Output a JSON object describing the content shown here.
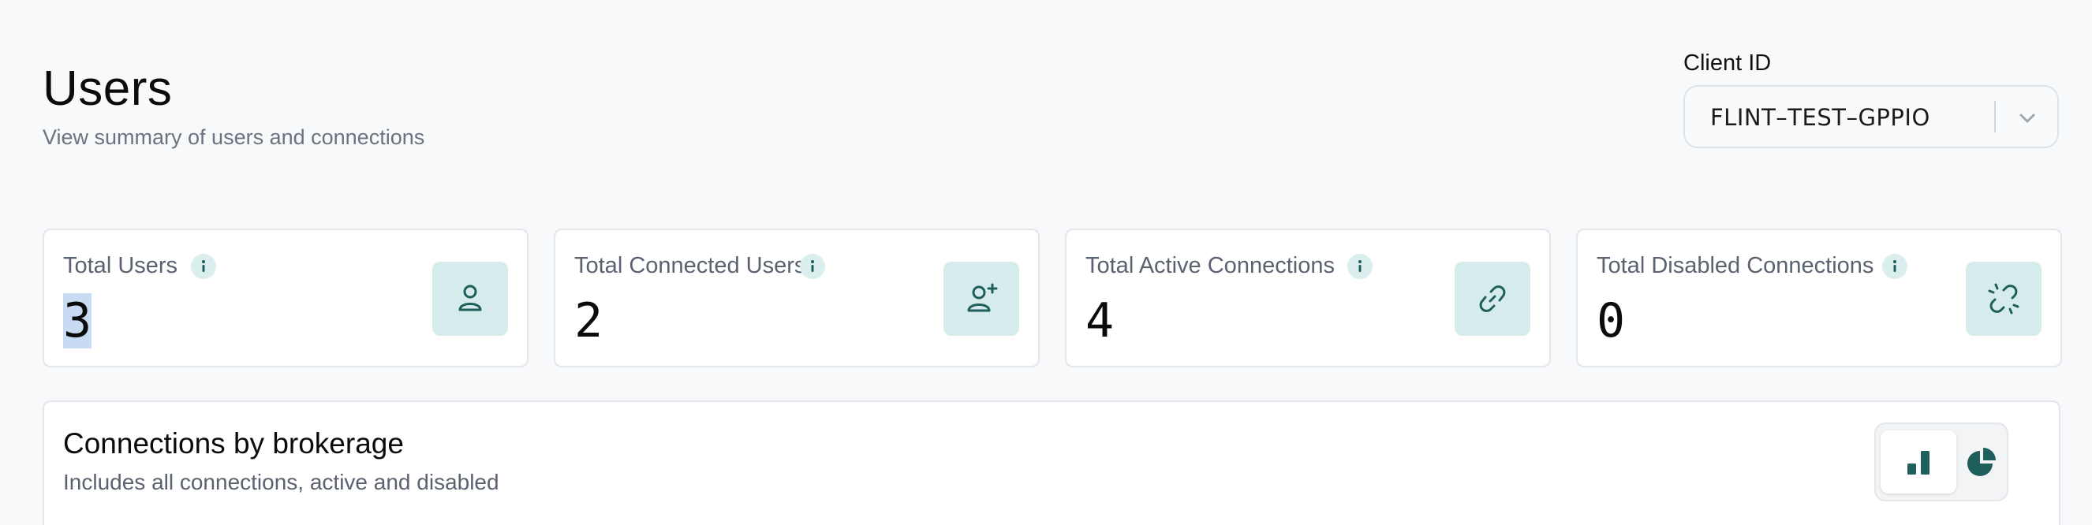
{
  "header": {
    "title": "Users",
    "subtitle": "View summary of users and connections"
  },
  "client": {
    "label": "Client ID",
    "selected": "FLINT–TEST–GPPIO"
  },
  "stats": [
    {
      "label": "Total Users",
      "value": "3",
      "icon": "user-icon"
    },
    {
      "label": "Total Connected Users",
      "value": "2",
      "icon": "user-plus-icon"
    },
    {
      "label": "Total Active Connections",
      "value": "4",
      "icon": "link-icon"
    },
    {
      "label": "Total Disabled Connections",
      "value": "0",
      "icon": "broken-link-icon"
    }
  ],
  "panel": {
    "title": "Connections by brokerage",
    "subtitle": "Includes all connections, active and disabled",
    "chart_toggle": [
      {
        "icon": "bar-chart-icon",
        "active": true
      },
      {
        "icon": "pie-chart-icon",
        "active": false
      }
    ]
  },
  "colors": {
    "accent": "#1f5f5b",
    "accent_bg": "#d6ecec",
    "info_bg": "#d9eeed",
    "muted_text": "#6b7380",
    "border": "#e2e5e9",
    "selection": "#c7dbf3"
  }
}
